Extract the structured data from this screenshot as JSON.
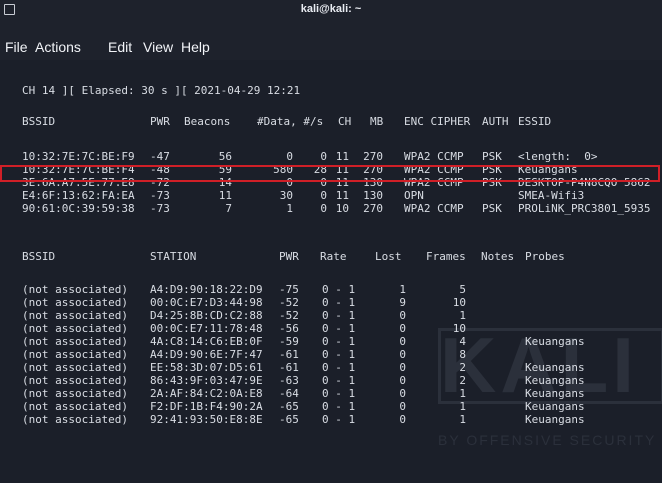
{
  "window": {
    "title": "kali@kali: ~"
  },
  "menu": [
    "File",
    "Actions",
    "Edit",
    "View",
    "Help"
  ],
  "status_line": "CH 14 ][ Elapsed: 30 s ][ 2021-04-29 12:21",
  "ap_table": {
    "headers": [
      "BSSID",
      "PWR",
      "Beacons",
      "#Data, #/s",
      "CH",
      "MB",
      "ENC CIPHER",
      "AUTH",
      "ESSID"
    ],
    "rows": [
      [
        "10:32:7E:7C:BE:F9",
        "-47",
        "56",
        "0",
        "0",
        "11",
        "270",
        "WPA2 CCMP",
        "PSK",
        "<length:  0>"
      ],
      [
        "10:32:7E:7C:BE:F4",
        "-48",
        "59",
        "580",
        "28",
        "11",
        "270",
        "WPA2 CCMP",
        "PSK",
        "Keuangans"
      ],
      [
        "3E:6A:A7:5E:77:E8",
        "-72",
        "14",
        "0",
        "0",
        "11",
        "130",
        "WPA2 CCMP",
        "PSK",
        "DESKTOP-P4N8CQO 5862"
      ],
      [
        "E4:6F:13:62:FA:EA",
        "-73",
        "11",
        "30",
        "0",
        "11",
        "130",
        "OPN",
        "",
        "SMEA-Wifi3"
      ],
      [
        "90:61:0C:39:59:38",
        "-73",
        "7",
        "1",
        "0",
        "10",
        "270",
        "WPA2 CCMP",
        "PSK",
        "PROLiNK_PRC3801_5935"
      ]
    ]
  },
  "station_table": {
    "headers": [
      "BSSID",
      "STATION",
      "PWR",
      "Rate",
      "Lost",
      "Frames",
      "Notes",
      "Probes"
    ],
    "rows": [
      [
        "(not associated)",
        "A4:D9:90:18:22:D9",
        "-75",
        "0 - 1",
        "1",
        "5",
        ""
      ],
      [
        "(not associated)",
        "00:0C:E7:D3:44:98",
        "-52",
        "0 - 1",
        "9",
        "10",
        ""
      ],
      [
        "(not associated)",
        "D4:25:8B:CD:C2:88",
        "-52",
        "0 - 1",
        "0",
        "1",
        ""
      ],
      [
        "(not associated)",
        "00:0C:E7:11:78:48",
        "-56",
        "0 - 1",
        "0",
        "10",
        ""
      ],
      [
        "(not associated)",
        "4A:C8:14:C6:EB:0F",
        "-59",
        "0 - 1",
        "0",
        "4",
        "Keuangans"
      ],
      [
        "(not associated)",
        "A4:D9:90:6E:7F:47",
        "-61",
        "0 - 1",
        "0",
        "8",
        ""
      ],
      [
        "(not associated)",
        "EE:58:3D:07:D5:61",
        "-61",
        "0 - 1",
        "0",
        "2",
        "Keuangans"
      ],
      [
        "(not associated)",
        "86:43:9F:03:47:9E",
        "-63",
        "0 - 1",
        "0",
        "2",
        "Keuangans"
      ],
      [
        "(not associated)",
        "2A:AF:84:C2:0A:E8",
        "-64",
        "0 - 1",
        "0",
        "1",
        "Keuangans"
      ],
      [
        "(not associated)",
        "F2:DF:1B:F4:90:2A",
        "-65",
        "0 - 1",
        "0",
        "1",
        "Keuangans"
      ],
      [
        "(not associated)",
        "92:41:93:50:E8:8E",
        "-65",
        "0 - 1",
        "0",
        "1",
        "Keuangans"
      ]
    ]
  },
  "watermark": {
    "logo": "KALI",
    "tagline": "BY OFFENSIVE SECURITY"
  },
  "colors": {
    "highlight": "#d01f27",
    "terminal_bg": "#1b1f29",
    "text": "#d9dde4"
  }
}
